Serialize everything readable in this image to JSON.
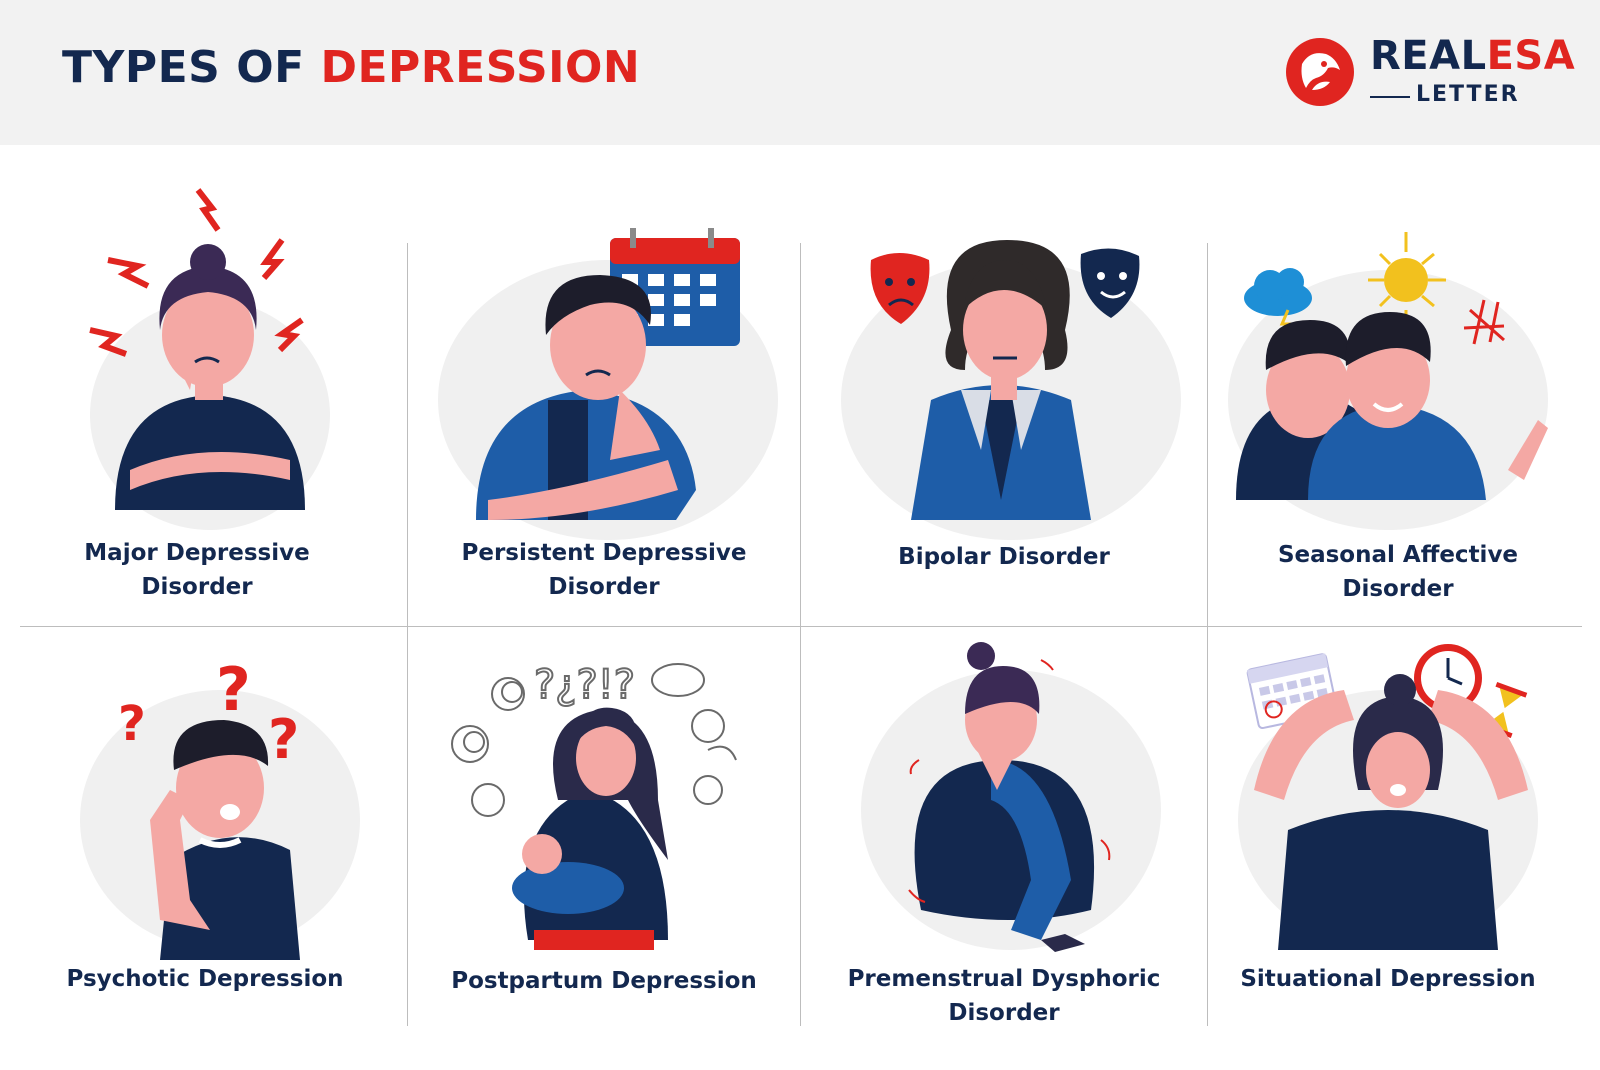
{
  "header": {
    "title_part1": "TYPES OF ",
    "title_part2": "DEPRESSION",
    "logo_real": "REAL",
    "logo_esa": "ESA",
    "logo_sub": "LETTER"
  },
  "colors": {
    "navy": "#13284f",
    "red": "#e02520",
    "blue": "#1e5da8",
    "header_bg": "#f2f2f2"
  },
  "cards": [
    {
      "line1": "Major Depressive",
      "line2": "Disorder",
      "icon": "stressed-woman-illustration"
    },
    {
      "line1": "Persistent Depressive",
      "line2": "Disorder",
      "icon": "sad-man-calendar-illustration"
    },
    {
      "line1": "Bipolar Disorder",
      "line2": "",
      "icon": "woman-with-masks-illustration"
    },
    {
      "line1": "Seasonal Affective",
      "line2": "Disorder",
      "icon": "two-boys-weather-illustration"
    },
    {
      "line1": "Psychotic Depression",
      "line2": "",
      "icon": "confused-man-question-marks-illustration"
    },
    {
      "line1": "Postpartum Depression",
      "line2": "",
      "icon": "mother-with-baby-illustration"
    },
    {
      "line1": "Premenstrual Dysphoric",
      "line2": "Disorder",
      "icon": "crouching-woman-illustration"
    },
    {
      "line1": "Situational Depression",
      "line2": "",
      "icon": "stressed-woman-clock-illustration"
    }
  ]
}
